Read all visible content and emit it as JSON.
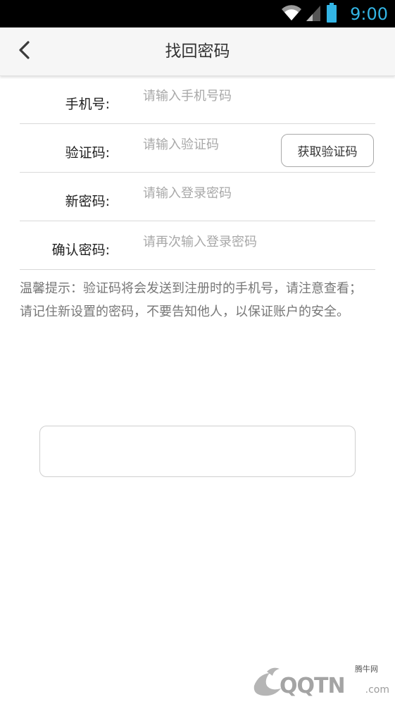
{
  "status_bar": {
    "time": "9:00",
    "wifi_icon": "wifi-icon",
    "signal_icon": "signal-icon",
    "battery_icon": "battery-icon",
    "accent_color": "#33b5e5"
  },
  "header": {
    "title": "找回密码",
    "back_icon": "chevron-left-icon"
  },
  "form": {
    "phone": {
      "label": "手机号:",
      "placeholder": "请输入手机号码",
      "value": ""
    },
    "code": {
      "label": "验证码:",
      "placeholder": "请输入验证码",
      "value": "",
      "button_label": "获取验证码"
    },
    "new_password": {
      "label": "新密码:",
      "placeholder": "请输入登录密码",
      "value": ""
    },
    "confirm_password": {
      "label": "确认密码:",
      "placeholder": "请再次输入登录密码",
      "value": ""
    }
  },
  "tip": "温馨提示：验证码将会发送到注册时的手机号，请注意查看；请记住新设置的密码，不要告知他人，以保证账户的安全。",
  "submit": {
    "label": ""
  },
  "watermark": {
    "small_text": "腾牛网",
    "brand_text": "QQTN",
    "suffix": ".com"
  }
}
